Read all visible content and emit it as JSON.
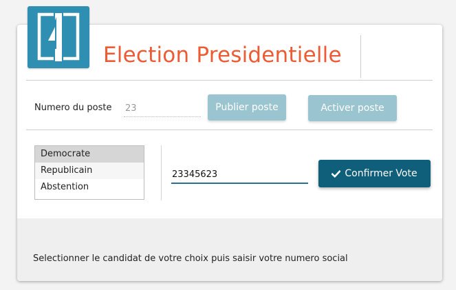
{
  "header": {
    "title": "Election Presidentielle",
    "logo_icon": "split-door-logo-icon",
    "title_color": "#ee5a33",
    "logo_color": "#2f8fb3"
  },
  "post": {
    "label": "Numero du poste",
    "value": "23",
    "publish_label": "Publier poste",
    "activate_label": "Activer poste"
  },
  "vote": {
    "candidates": [
      "Democrate",
      "Republicain",
      "Abstention"
    ],
    "selected_candidate": "Democrate",
    "social_number": "23345623",
    "confirm_label": "Confirmer Vote",
    "confirm_icon": "check-icon",
    "accent_color": "#0f5e7a"
  },
  "footer": {
    "instruction": "Selectionner le candidat de votre choix puis saisir votre numero social"
  }
}
